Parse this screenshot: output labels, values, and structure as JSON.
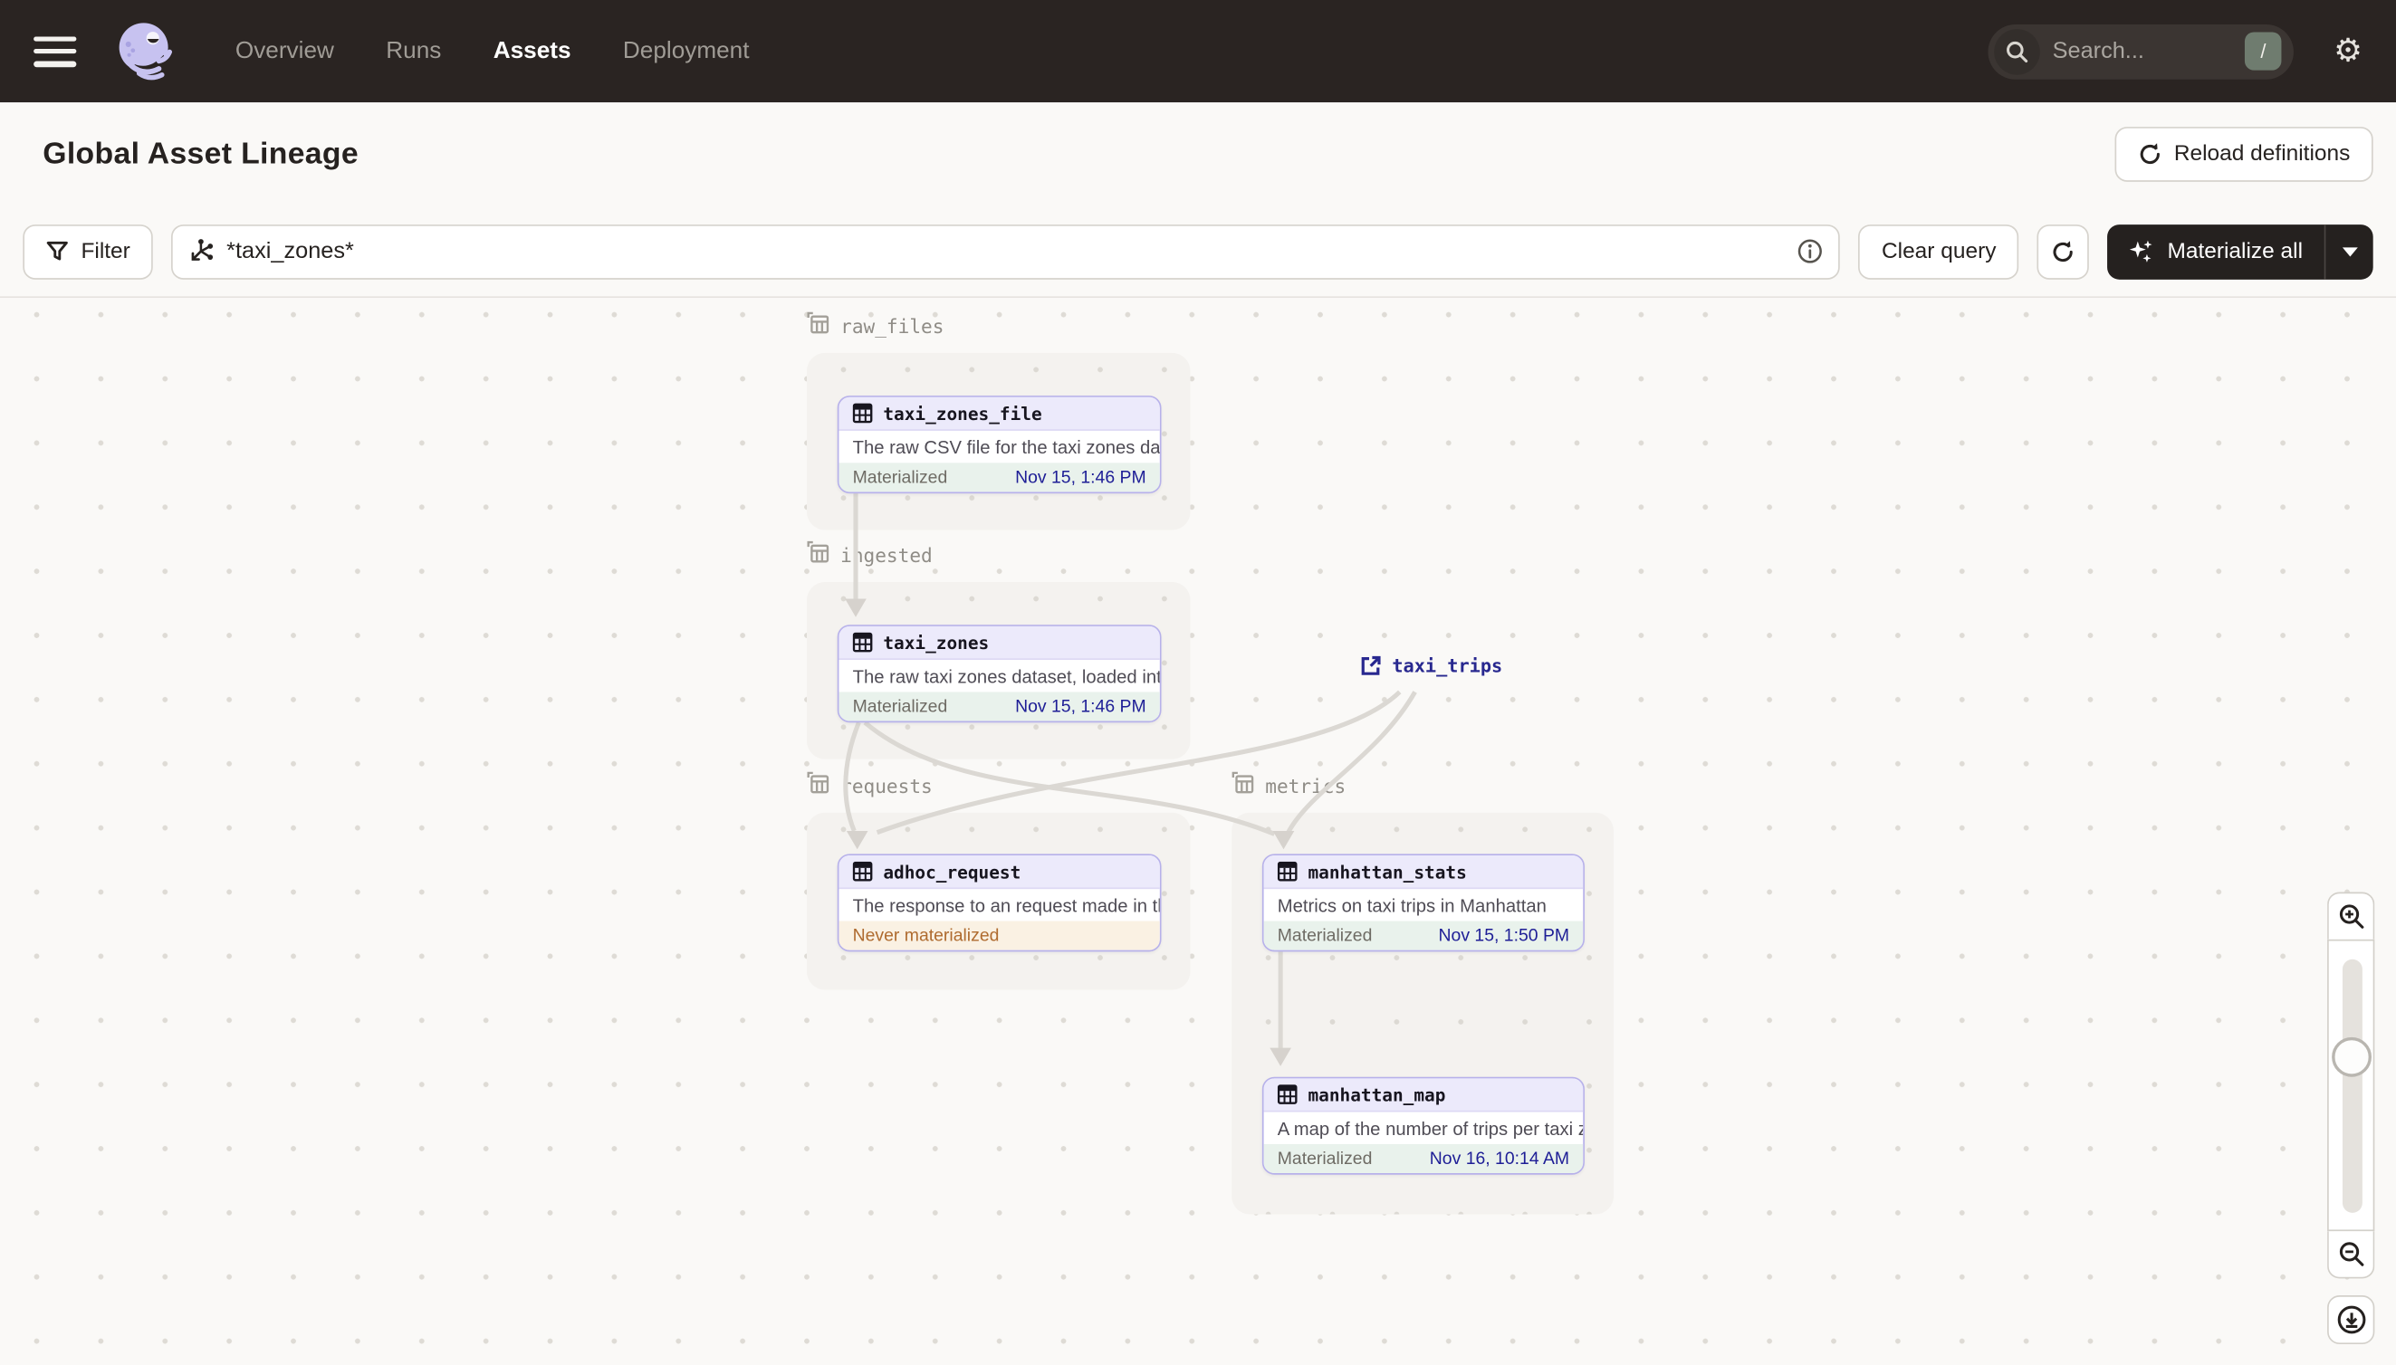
{
  "header": {
    "nav": [
      {
        "label": "Overview",
        "active": false
      },
      {
        "label": "Runs",
        "active": false
      },
      {
        "label": "Assets",
        "active": true
      },
      {
        "label": "Deployment",
        "active": false
      }
    ],
    "search": {
      "placeholder": "Search...",
      "shortcut": "/"
    }
  },
  "page": {
    "title": "Global Asset Lineage",
    "reload_button": "Reload definitions"
  },
  "toolbar": {
    "filter_label": "Filter",
    "query_value": "*taxi_zones*",
    "clear_button": "Clear query",
    "materialize_button": "Materialize all"
  },
  "graph": {
    "groups": [
      {
        "name": "raw_files"
      },
      {
        "name": "ingested"
      },
      {
        "name": "requests"
      },
      {
        "name": "metrics"
      }
    ],
    "nodes": [
      {
        "title": "taxi_zones_file",
        "description": "The raw CSV file for the taxi zones dat...",
        "status": "Materialized",
        "timestamp": "Nov 15, 1:46 PM",
        "state": "materialized"
      },
      {
        "title": "taxi_zones",
        "description": "The raw taxi zones dataset, loaded int...",
        "status": "Materialized",
        "timestamp": "Nov 15, 1:46 PM",
        "state": "materialized"
      },
      {
        "title": "adhoc_request",
        "description": "The response to an request made in th...",
        "status": "Never materialized",
        "timestamp": "",
        "state": "never"
      },
      {
        "title": "manhattan_stats",
        "description": "Metrics on taxi trips in Manhattan",
        "status": "Materialized",
        "timestamp": "Nov 15, 1:50 PM",
        "state": "materialized"
      },
      {
        "title": "manhattan_map",
        "description": "A map of the number of trips per taxi z...",
        "status": "Materialized",
        "timestamp": "Nov 16, 10:14 AM",
        "state": "materialized"
      }
    ],
    "external_nodes": [
      {
        "title": "taxi_trips"
      }
    ]
  },
  "colors": {
    "topbar_bg": "#2A2422",
    "accent_lavender": "#B7B1EA",
    "node_header_bg": "#ECEAFB",
    "materialized_bg": "#E9F2EC",
    "never_materialized_bg": "#FAF1E3",
    "never_materialized_text": "#AF6B2F",
    "timestamp_text": "#1E1E96",
    "edge": "#DBD8D3",
    "logo_lavender": "#C7C2F0"
  }
}
